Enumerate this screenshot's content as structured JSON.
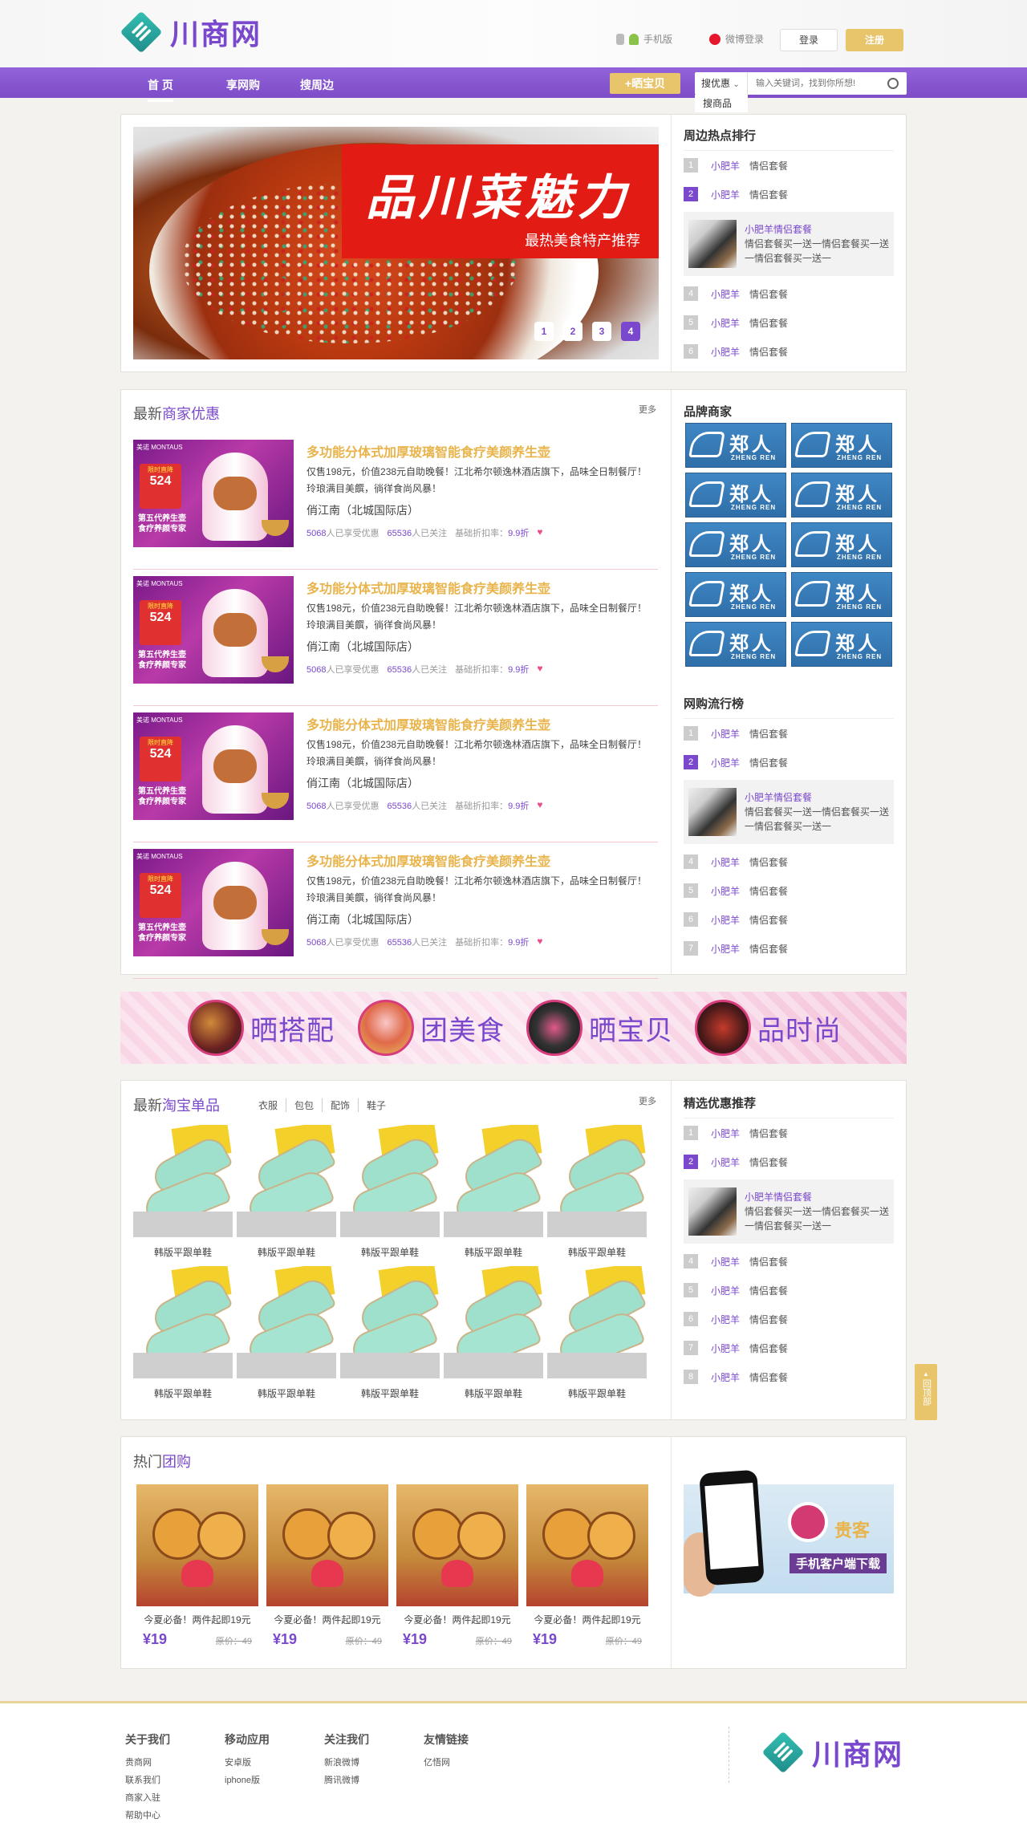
{
  "header": {
    "logo_text": "川商网",
    "mobile_label": "手机版",
    "weibo_label": "微博登录",
    "login_label": "登录",
    "register_label": "注册"
  },
  "nav": {
    "items": [
      "首 页",
      "享网购",
      "搜周边"
    ],
    "share_button": "+晒宝贝",
    "search_type": "搜优惠",
    "search_placeholder": "输入关键词，找到你所想!",
    "search_dropdown_option": "搜商品"
  },
  "banner": {
    "headline": "品川菜魅力",
    "subline": "最热美食特产推荐",
    "pages": [
      "1",
      "2",
      "3",
      "4"
    ],
    "active_page": 4
  },
  "hot_rank": {
    "title": "周边热点排行",
    "rows": [
      {
        "num": "1",
        "a": "小肥羊",
        "b": "情侣套餐"
      },
      {
        "num": "2",
        "a": "小肥羊",
        "b": "情侣套餐"
      }
    ],
    "feature": {
      "title": "小肥羊情侣套餐",
      "desc": "情侣套餐买一送一情侣套餐买一送一情侣套餐买一送一"
    },
    "rows2": [
      {
        "num": "4",
        "a": "小肥羊",
        "b": "情侣套餐"
      },
      {
        "num": "5",
        "a": "小肥羊",
        "b": "情侣套餐"
      },
      {
        "num": "6",
        "a": "小肥羊",
        "b": "情侣套餐"
      }
    ]
  },
  "deals": {
    "title_prefix": "最新",
    "title_hl": "商家优惠",
    "more": "更多",
    "items": [
      {
        "title": "多功能分体式加厚玻璃智能食疗美颜养生壶",
        "desc": "仅售198元，价值238元自助晚餐！江北希尔顿逸林酒店旗下，品味全日制餐厅！玲琅满目美饌，徜徉食尚风暴！",
        "shop": "俏江南（北城国际店）",
        "enjoyed": "5068",
        "enjoyed_label": "人已享受优惠",
        "follow": "65536",
        "follow_label": "人已关注",
        "discount_label": "基础折扣率：",
        "discount": "9.9折",
        "img_brand": "美诺 MONTAUS",
        "img_price_label": "限时直降",
        "img_price": "524",
        "img_text": "第五代养生壶 食疗养颜专家"
      },
      {
        "title": "多功能分体式加厚玻璃智能食疗美颜养生壶",
        "desc": "仅售198元，价值238元自助晚餐！江北希尔顿逸林酒店旗下，品味全日制餐厅！玲琅满目美饌，徜徉食尚风暴！",
        "shop": "俏江南（北城国际店）",
        "enjoyed": "5068",
        "enjoyed_label": "人已享受优惠",
        "follow": "65536",
        "follow_label": "人已关注",
        "discount_label": "基础折扣率：",
        "discount": "9.9折",
        "img_brand": "美诺 MONTAUS",
        "img_price_label": "限时直降",
        "img_price": "524",
        "img_text": "第五代养生壶 食疗养颜专家"
      },
      {
        "title": "多功能分体式加厚玻璃智能食疗美颜养生壶",
        "desc": "仅售198元，价值238元自助晚餐！江北希尔顿逸林酒店旗下，品味全日制餐厅！玲琅满目美饌，徜徉食尚风暴！",
        "shop": "俏江南（北城国际店）",
        "enjoyed": "5068",
        "enjoyed_label": "人已享受优惠",
        "follow": "65536",
        "follow_label": "人已关注",
        "discount_label": "基础折扣率：",
        "discount": "9.9折",
        "img_brand": "美诺 MONTAUS",
        "img_price_label": "限时直降",
        "img_price": "524",
        "img_text": "第五代养生壶 食疗养颜专家"
      },
      {
        "title": "多功能分体式加厚玻璃智能食疗美颜养生壶",
        "desc": "仅售198元，价值238元自助晚餐！江北希尔顿逸林酒店旗下，品味全日制餐厅！玲琅满目美饌，徜徉食尚风暴！",
        "shop": "俏江南（北城国际店）",
        "enjoyed": "5068",
        "enjoyed_label": "人已享受优惠",
        "follow": "65536",
        "follow_label": "人已关注",
        "discount_label": "基础折扣率：",
        "discount": "9.9折",
        "img_brand": "美诺 MONTAUS",
        "img_price_label": "限时直降",
        "img_price": "524",
        "img_text": "第五代养生壶 食疗养颜专家"
      }
    ]
  },
  "brands": {
    "title": "品牌商家",
    "logo_zh": "郑人",
    "logo_en": "ZHENG REN",
    "count": 10
  },
  "online_rank": {
    "title": "网购流行榜",
    "rows": [
      {
        "num": "1",
        "a": "小肥羊",
        "b": "情侣套餐"
      },
      {
        "num": "2",
        "a": "小肥羊",
        "b": "情侣套餐"
      }
    ],
    "feature": {
      "title": "小肥羊情侣套餐",
      "desc": "情侣套餐买一送一情侣套餐买一送一情侣套餐买一送一"
    },
    "rows2": [
      {
        "num": "4",
        "a": "小肥羊",
        "b": "情侣套餐"
      },
      {
        "num": "5",
        "a": "小肥羊",
        "b": "情侣套餐"
      },
      {
        "num": "6",
        "a": "小肥羊",
        "b": "情侣套餐"
      },
      {
        "num": "7",
        "a": "小肥羊",
        "b": "情侣套餐"
      }
    ]
  },
  "promo_banner": {
    "items": [
      "晒搭配",
      "团美食",
      "晒宝贝",
      "品时尚"
    ]
  },
  "taobao": {
    "title_prefix": "最新",
    "title_hl": "淘宝单品",
    "tabs": [
      "衣服",
      "包包",
      "配饰",
      "鞋子"
    ],
    "more": "更多",
    "items": [
      "韩版平跟单鞋",
      "韩版平跟单鞋",
      "韩版平跟单鞋",
      "韩版平跟单鞋",
      "韩版平跟单鞋",
      "韩版平跟单鞋",
      "韩版平跟单鞋",
      "韩版平跟单鞋",
      "韩版平跟单鞋",
      "韩版平跟单鞋"
    ]
  },
  "picks": {
    "title": "精选优惠推荐",
    "rows": [
      {
        "num": "1",
        "a": "小肥羊",
        "b": "情侣套餐"
      },
      {
        "num": "2",
        "a": "小肥羊",
        "b": "情侣套餐"
      }
    ],
    "feature": {
      "title": "小肥羊情侣套餐",
      "desc": "情侣套餐买一送一情侣套餐买一送一情侣套餐买一送一"
    },
    "rows2": [
      {
        "num": "4",
        "a": "小肥羊",
        "b": "情侣套餐"
      },
      {
        "num": "5",
        "a": "小肥羊",
        "b": "情侣套餐"
      },
      {
        "num": "6",
        "a": "小肥羊",
        "b": "情侣套餐"
      },
      {
        "num": "7",
        "a": "小肥羊",
        "b": "情侣套餐"
      },
      {
        "num": "8",
        "a": "小肥羊",
        "b": "情侣套餐"
      }
    ]
  },
  "group_buy": {
    "title_prefix": "热门",
    "title_hl": "团购",
    "items": [
      {
        "caption": "今夏必备！两件起即19元",
        "price": "¥19",
        "orig": "原价：49"
      },
      {
        "caption": "今夏必备！两件起即19元",
        "price": "¥19",
        "orig": "原价：49"
      },
      {
        "caption": "今夏必备！两件起即19元",
        "price": "¥19",
        "orig": "原价：49"
      },
      {
        "caption": "今夏必备！两件起即19元",
        "price": "¥19",
        "orig": "原价：49"
      }
    ]
  },
  "app_ad": {
    "brand": "贵客",
    "cta": "手机客户端下载"
  },
  "back_top": "回顶部",
  "footer": {
    "cols": [
      {
        "title": "关于我们",
        "links": [
          "贵商网",
          "联系我们",
          "商家入驻",
          "帮助中心"
        ]
      },
      {
        "title": "移动应用",
        "links": [
          "安卓版",
          "iphone版"
        ]
      },
      {
        "title": "关注我们",
        "links": [
          "新浪微博",
          "腾讯微博"
        ]
      },
      {
        "title": "友情链接",
        "links": [
          "亿悟网"
        ]
      }
    ],
    "logo_text": "川商网"
  }
}
